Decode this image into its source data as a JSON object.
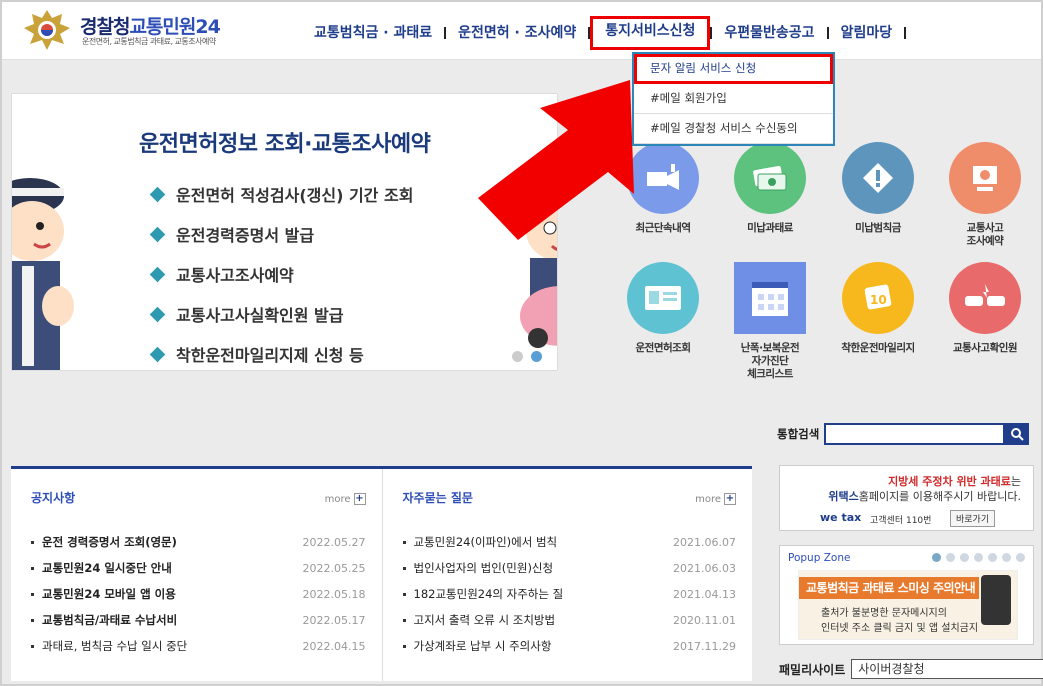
{
  "logo": {
    "title_a": "경찰청",
    "title_b": "교통민원24",
    "subtitle": "운전면허, 교통범칙금 과태료, 교통조사예약"
  },
  "gnb": [
    {
      "label": "교통범칙금 · 과태료"
    },
    {
      "label": "운전면허 · 조사예약"
    },
    {
      "label": "통지서비스신청"
    },
    {
      "label": "우편물반송공고"
    },
    {
      "label": "알림마당"
    }
  ],
  "dropdown": [
    {
      "label": "문자 알림 서비스 신청"
    },
    {
      "label": "#메일 회원가입"
    },
    {
      "label": "#메일 경찰청 서비스 수신동의"
    }
  ],
  "banner": {
    "title": "운전면허정보 조회·교통조사예약",
    "items": [
      "운전면허 적성검사(갱신) 기간 조회",
      "운전경력증명서 발급",
      "교통사고조사예약",
      "교통사고사실확인원 발급",
      "착한운전마일리지제 신청 등"
    ]
  },
  "quick": [
    {
      "label": "최근단속내역",
      "color": "#7b9bea",
      "icon": "camera-icon"
    },
    {
      "label": "미납과태료",
      "color": "#5cc27e",
      "icon": "money-icon"
    },
    {
      "label": "미납범칙금",
      "color": "#5e95bd",
      "icon": "warning-icon"
    },
    {
      "label": "교통사고\n조사예약",
      "color": "#ef8c6a",
      "icon": "computer-icon"
    },
    {
      "label": "운전면허조회",
      "color": "#5ec2d2",
      "icon": "license-card-icon"
    },
    {
      "label": "난폭·보복운전\n자가진단\n체크리스트",
      "color": "#6f8ee6",
      "icon": "checklist-icon"
    },
    {
      "label": "착한운전마일리지",
      "color": "#f6b81c",
      "icon": "mileage-icon"
    },
    {
      "label": "교통사고확인원",
      "color": "#e86a6a",
      "icon": "car-crash-icon"
    }
  ],
  "search": {
    "label": "통합검색",
    "placeholder": ""
  },
  "notice": {
    "title": "공지사항",
    "more": "more",
    "rows": [
      {
        "text": "운전 경력증명서 조회(영문)",
        "date": "2022.05.27",
        "bold": true
      },
      {
        "text": "교통민원24 일시중단 안내",
        "date": "2022.05.25",
        "bold": true
      },
      {
        "text": "교통민원24 모바일 앱 이용",
        "date": "2022.05.18",
        "bold": true
      },
      {
        "text": "교통범칙금/과태료 수납서비",
        "date": "2022.05.17",
        "bold": true
      },
      {
        "text": "과태료, 범칙금 수납 일시 중단",
        "date": "2022.04.15",
        "bold": false
      }
    ]
  },
  "faq": {
    "title": "자주묻는 질문",
    "more": "more",
    "rows": [
      {
        "text": "교통민원24(이파인)에서 범칙",
        "date": "2021.06.07"
      },
      {
        "text": "법인사업자의 법인(민원)신청",
        "date": "2021.06.03"
      },
      {
        "text": "182교통민원24의 자주하는 질",
        "date": "2021.04.13"
      },
      {
        "text": "고지서 출력 오류 시 조치방법",
        "date": "2020.11.01"
      },
      {
        "text": "가상계좌로 납부 시 주의사항",
        "date": "2017.11.29"
      }
    ]
  },
  "wetax": {
    "line1_a": "지방세 주정차 위반 과태료",
    "line1_b": "는",
    "line2_a": "위택스",
    "line2_b": "홈페이지를 이용해주시기 바랍니다.",
    "logo": "we tax",
    "tel": "고객센터 110번",
    "button": "바로가기"
  },
  "popup": {
    "title": "Popup Zone",
    "head": "교통범칙금 과태료 스미싱 주의안내",
    "line1": "출처가 불분명한 문자메시지의",
    "line2": "인터넷 주소 클릭 금지 및 앱 설치금지"
  },
  "family": {
    "label": "패밀리사이트",
    "selected": "사이버경찰청"
  }
}
